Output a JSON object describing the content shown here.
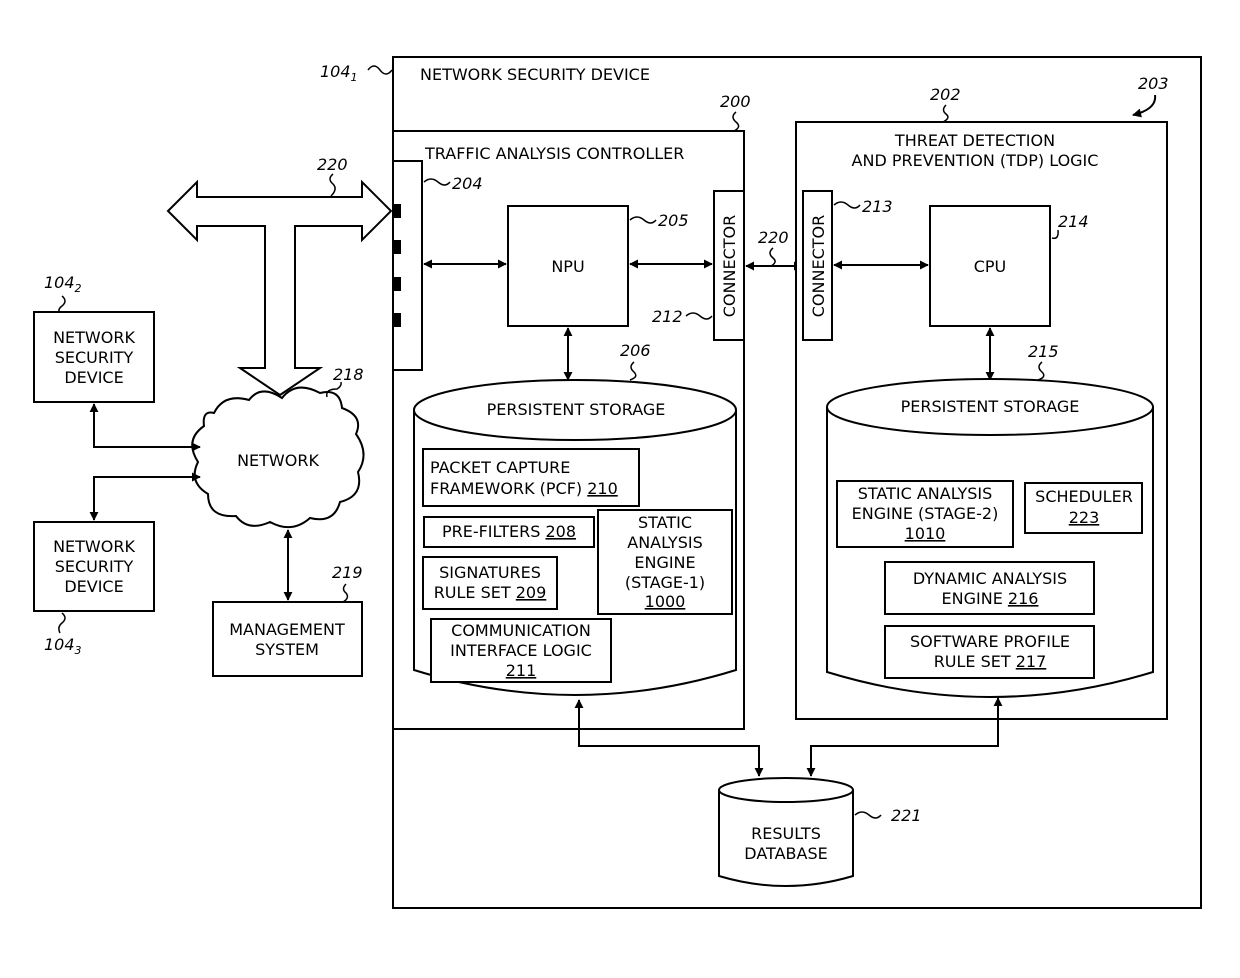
{
  "diagram": {
    "main_device": {
      "label": "NETWORK SECURITY DEVICE",
      "ref": "104",
      "ref_sub": "1"
    },
    "traffic_controller": {
      "label": "TRAFFIC ANALYSIS CONTROLLER",
      "ref": "200",
      "interface_ref": "204",
      "npu": {
        "label": "NPU",
        "ref": "205"
      },
      "connector": {
        "label": "CONNECTOR",
        "ref": "212"
      },
      "storage": {
        "label": "PERSISTENT STORAGE",
        "ref": "206",
        "modules": {
          "pcf": {
            "line1": "PACKET CAPTURE",
            "line2": "FRAMEWORK (PCF) ",
            "num": "210"
          },
          "prefilters": {
            "line1": "PRE-FILTERS ",
            "num": "208"
          },
          "signatures": {
            "line1": "SIGNATURES",
            "line2": "RULE SET ",
            "num": "209"
          },
          "static1": {
            "line1": "STATIC",
            "line2": "ANALYSIS",
            "line3": "ENGINE",
            "line4": "(STAGE-1)",
            "num": "1000"
          },
          "comm": {
            "line1": "COMMUNICATION",
            "line2": "INTERFACE LOGIC",
            "num": "211"
          }
        }
      }
    },
    "tdp_logic": {
      "line1": "THREAT DETECTION",
      "line2": "AND PREVENTION (TDP) LOGIC",
      "ref": "202",
      "group_ref": "203",
      "connector": {
        "label": "CONNECTOR",
        "ref": "213"
      },
      "cpu": {
        "label": "CPU",
        "ref": "214"
      },
      "storage": {
        "label": "PERSISTENT STORAGE",
        "ref": "215",
        "modules": {
          "static2": {
            "line1": "STATIC ANALYSIS",
            "line2": "ENGINE (STAGE-2)",
            "num": "1010"
          },
          "scheduler": {
            "line1": "SCHEDULER",
            "num": "223"
          },
          "dynamic": {
            "line1": "DYNAMIC ANALYSIS",
            "line2": "ENGINE  ",
            "num": "216"
          },
          "profile": {
            "line1": "SOFTWARE PROFILE",
            "line2": "RULE SET  ",
            "num": "217"
          }
        }
      }
    },
    "link_ref": "220",
    "bus_ref": "220",
    "results_db": {
      "line1": "RESULTS",
      "line2": "DATABASE",
      "ref": "221"
    },
    "network": {
      "label": "NETWORK",
      "ref": "218"
    },
    "management": {
      "line1": "MANAGEMENT",
      "line2": "SYSTEM",
      "ref": "219"
    },
    "device2": {
      "line1": "NETWORK",
      "line2": "SECURITY",
      "line3": "DEVICE",
      "ref": "104",
      "ref_sub": "2"
    },
    "device3": {
      "line1": "NETWORK",
      "line2": "SECURITY",
      "line3": "DEVICE",
      "ref": "104",
      "ref_sub": "3"
    }
  }
}
